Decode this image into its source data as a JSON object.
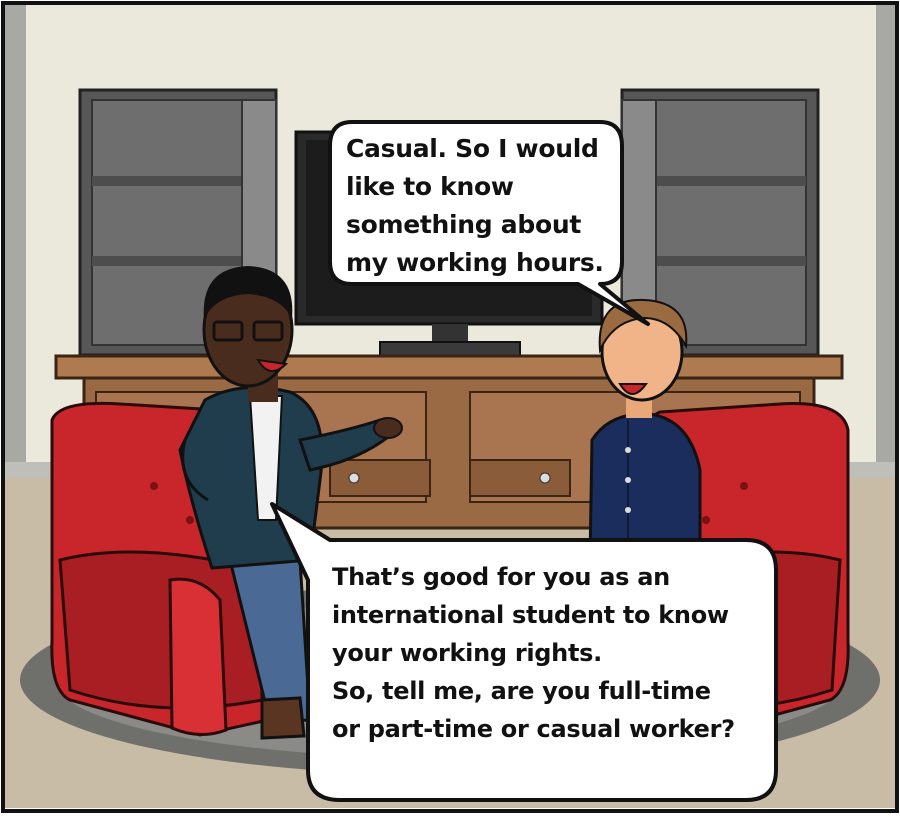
{
  "comic": {
    "bubbles": [
      {
        "speaker": "young man",
        "text": "Casual. So I would\nlike to know\nsomething about\nmy working hours."
      },
      {
        "speaker": "advisor",
        "text": "That’s good for you as an\ninternational student to know\nyour working rights.\nSo, tell me, are you full-time\nor part-time or casual worker?"
      }
    ]
  },
  "colors": {
    "wall": "#ebe8dc",
    "floor": "#c9bca6",
    "rug": "#7d7d7a",
    "sofa": "#c8262a",
    "shelf": "#5e5e5e",
    "cabinet": "#9a6a45",
    "advisor_jacket": "#1f3d4c",
    "student_shirt": "#1b2d5c"
  }
}
